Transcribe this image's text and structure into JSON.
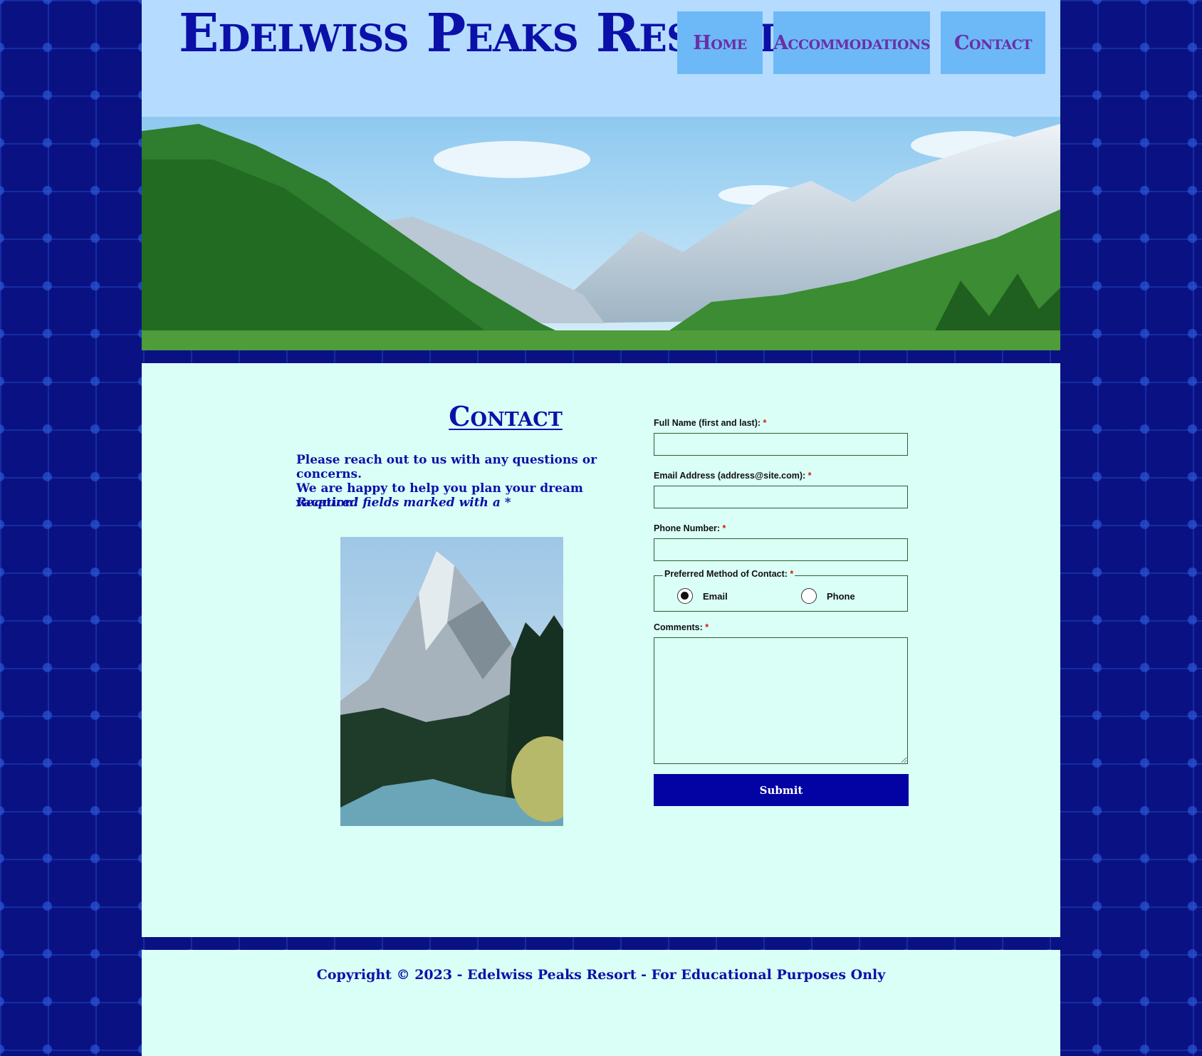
{
  "header": {
    "site_title": "Edelwiss Peaks Resort"
  },
  "nav": {
    "items": [
      {
        "label": "Home"
      },
      {
        "label": "Accommodations"
      },
      {
        "label": "Contact"
      }
    ]
  },
  "main": {
    "heading": "Contact",
    "intro_line1": "Please reach out to us with any questions or concerns.",
    "intro_line2": "We are happy to help you plan your dream vacation!",
    "required_note": "Required fields marked with a *"
  },
  "form": {
    "full_name_label": "Full Name (first and last):",
    "full_name_value": "",
    "email_label": "Email Address (address@site.com):",
    "email_value": "",
    "phone_label": "Phone Number:",
    "phone_value": "",
    "contact_method_legend": "Preferred Method of Contact:",
    "contact_options": [
      {
        "label": "Email",
        "checked": true
      },
      {
        "label": "Phone",
        "checked": false
      }
    ],
    "comments_label": "Comments:",
    "comments_value": "",
    "required_marker": "*",
    "submit_label": "Submit"
  },
  "footer": {
    "copyright": "Copyright © 2023 - Edelwiss Peaks Resort - For Educational Purposes Only"
  },
  "colors": {
    "header_bg": "#b5dcff",
    "nav_bg": "#6db8f6",
    "nav_text": "#6a2fa8",
    "main_bg": "#dafff7",
    "accent_text": "#0b11a8",
    "submit_bg": "#0303a3",
    "page_bg": "#0a1283"
  }
}
